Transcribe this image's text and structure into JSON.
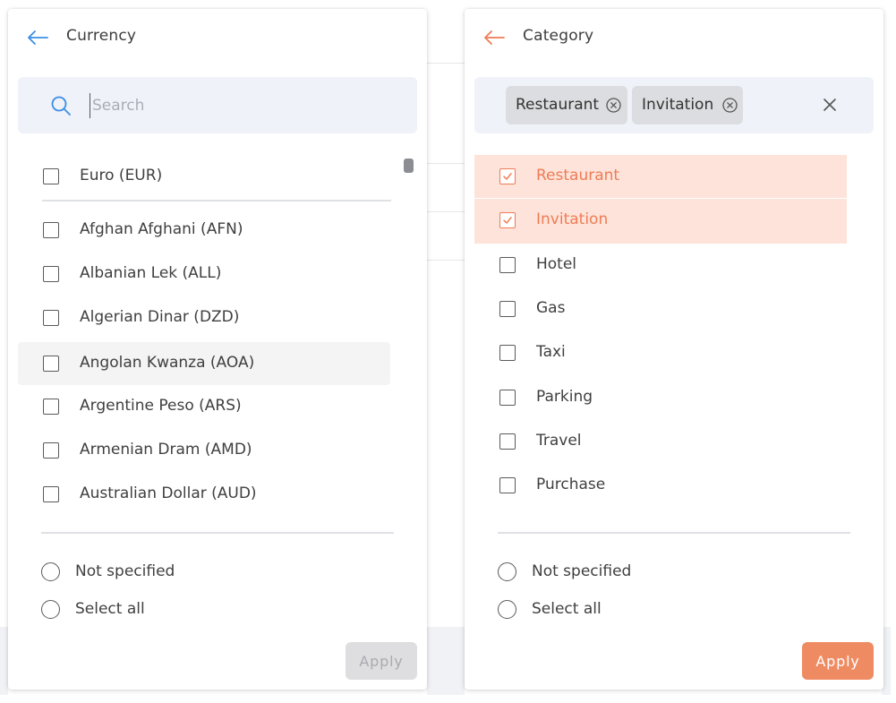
{
  "colors": {
    "accent_left": "#3a8ee6",
    "accent_right": "#ef7c55",
    "selected_bg": "#fde3d9",
    "apply_active": "#ef8b63",
    "apply_disabled": "#dedee0"
  },
  "currency_panel": {
    "title": "Currency",
    "back_icon": "arrow-left-icon",
    "search": {
      "placeholder": "Search",
      "value": "",
      "icon": "search-icon"
    },
    "items": [
      {
        "label": "Euro (EUR)",
        "checked": false
      },
      {
        "label": "Afghan Afghani (AFN)",
        "checked": false
      },
      {
        "label": "Albanian Lek (ALL)",
        "checked": false
      },
      {
        "label": "Algerian Dinar (DZD)",
        "checked": false
      },
      {
        "label": "Angolan Kwanza (AOA)",
        "checked": false,
        "hovered": true
      },
      {
        "label": "Argentine Peso (ARS)",
        "checked": false
      },
      {
        "label": "Armenian Dram (AMD)",
        "checked": false
      },
      {
        "label": "Australian Dollar (AUD)",
        "checked": false
      }
    ],
    "radio_options": [
      {
        "label": "Not specified",
        "selected": false
      },
      {
        "label": "Select all",
        "selected": false
      }
    ],
    "apply_label": "Apply",
    "apply_enabled": false
  },
  "category_panel": {
    "title": "Category",
    "back_icon": "arrow-left-icon",
    "chips": [
      {
        "label": "Restaurant",
        "icon": "circle-x-icon"
      },
      {
        "label": "Invitation",
        "icon": "circle-x-icon"
      }
    ],
    "clear_icon": "close-icon",
    "items": [
      {
        "label": "Restaurant",
        "checked": true
      },
      {
        "label": "Invitation",
        "checked": true
      },
      {
        "label": "Hotel",
        "checked": false
      },
      {
        "label": "Gas",
        "checked": false
      },
      {
        "label": "Taxi",
        "checked": false
      },
      {
        "label": "Parking",
        "checked": false
      },
      {
        "label": "Travel",
        "checked": false
      },
      {
        "label": "Purchase",
        "checked": false
      }
    ],
    "radio_options": [
      {
        "label": "Not specified",
        "selected": false
      },
      {
        "label": "Select all",
        "selected": false
      }
    ],
    "apply_label": "Apply",
    "apply_enabled": true
  }
}
